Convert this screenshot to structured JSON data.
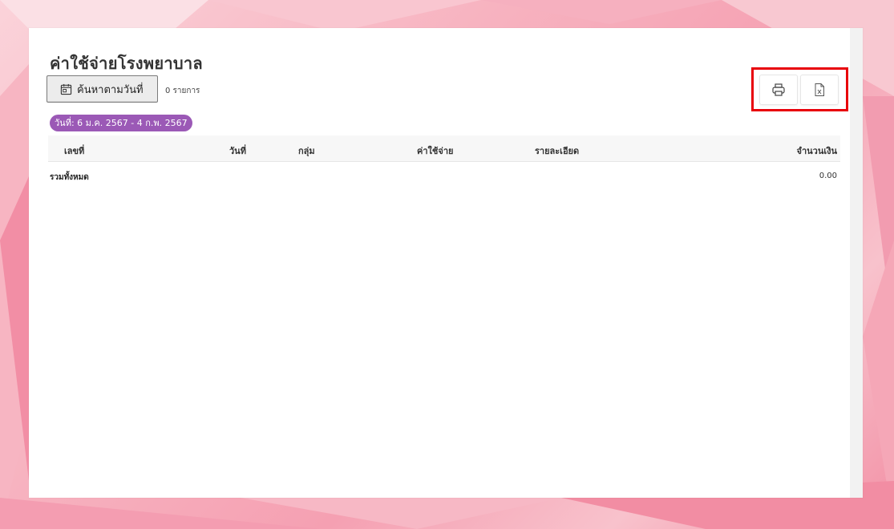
{
  "page": {
    "title": "ค่าใช้จ่ายโรงพยาบาล",
    "search_button_label": "ค้นหาตามวันที่",
    "record_count": "0 รายการ",
    "date_range": "วันที่: 6 ม.ค. 2567 - 4 ก.พ. 2567"
  },
  "toolbar": {
    "print_icon": "printer-icon",
    "excel_icon": "excel-file-icon"
  },
  "table": {
    "columns": [
      "เลขที่",
      "วันที่",
      "กลุ่ม",
      "ค่าใช้จ่าย",
      "รายละเอียด",
      "จำนวนเงิน"
    ],
    "rows": [],
    "total_label": "รวมทั้งหมด",
    "total_value": "0.00"
  },
  "colors": {
    "chip": "#9b59b6",
    "highlight": "#e8000a"
  }
}
